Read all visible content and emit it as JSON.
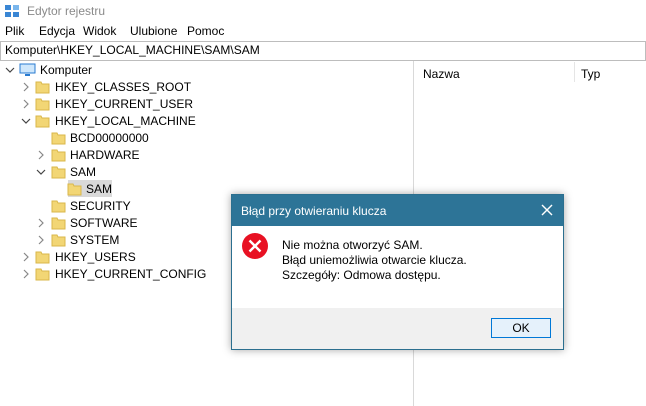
{
  "window": {
    "title": "Edytor rejestru"
  },
  "menu": [
    "Plik",
    "Edycja",
    "Widok",
    "Ulubione",
    "Pomoc"
  ],
  "address": "Komputer\\HKEY_LOCAL_MACHINE\\SAM\\SAM",
  "tree": [
    {
      "label": "Komputer",
      "chev": "down"
    },
    {
      "label": "HKEY_CLASSES_ROOT",
      "chev": "right"
    },
    {
      "label": "HKEY_CURRENT_USER",
      "chev": "right"
    },
    {
      "label": "HKEY_LOCAL_MACHINE",
      "chev": "down"
    },
    {
      "label": "BCD00000000",
      "chev": ""
    },
    {
      "label": "HARDWARE",
      "chev": "right"
    },
    {
      "label": "SAM",
      "chev": "down"
    },
    {
      "label": "SAM",
      "chev": "",
      "selected": true
    },
    {
      "label": "SECURITY",
      "chev": ""
    },
    {
      "label": "SOFTWARE",
      "chev": "right"
    },
    {
      "label": "SYSTEM",
      "chev": "right"
    },
    {
      "label": "HKEY_USERS",
      "chev": "right"
    },
    {
      "label": "HKEY_CURRENT_CONFIG",
      "chev": "right"
    }
  ],
  "list": {
    "col_name": "Nazwa",
    "col_type": "Typ"
  },
  "dialog": {
    "title": "Błąd przy otwieraniu klucza",
    "line1": "Nie można otworzyć SAM.",
    "line2": "Błąd uniemożliwia otwarcie klucza.",
    "line3": "Szczegóły: Odmowa dostępu.",
    "ok": "OK",
    "icon": "error-icon"
  },
  "colors": {
    "dialog_title_bg": "#2d7497",
    "error_red": "#e81123",
    "folder": "#f2d675"
  }
}
